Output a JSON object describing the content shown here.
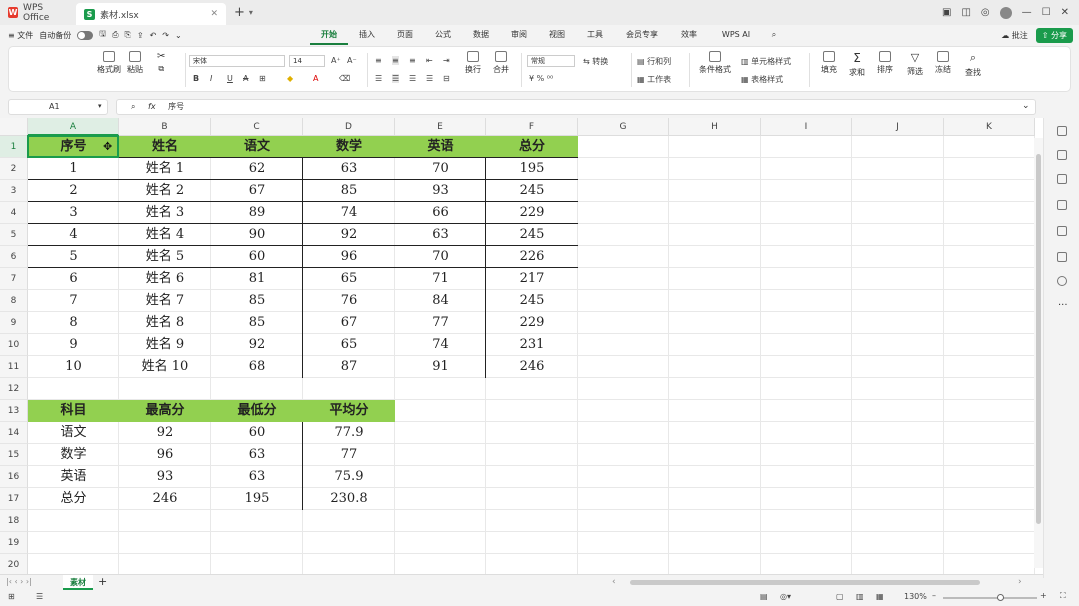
{
  "titlebar": {
    "app_tab": "WPS Office",
    "file_tab": "素材.xlsx",
    "new_tab_label": "+"
  },
  "menubar": {
    "file": "≡ 文件",
    "autosave": "自动备份",
    "tabs": [
      "开始",
      "插入",
      "页面",
      "公式",
      "数据",
      "审阅",
      "视图",
      "工具",
      "会员专享",
      "效率",
      "WPS AI"
    ],
    "active_tab": "开始",
    "share": "分享",
    "comment": "批注"
  },
  "ribbon": {
    "format_painter": "格式刷",
    "paste": "粘贴",
    "font_name": "宋体",
    "font_size": "14",
    "wrap": "换行",
    "merge": "合并",
    "number_format": "常规",
    "convert": "转换",
    "rows_cols": "行和列",
    "worksheet": "工作表",
    "cond_format": "条件格式",
    "cell_style": "单元格样式",
    "table_style": "表格样式",
    "fill": "填充",
    "sum": "求和",
    "sort": "排序",
    "filter": "筛选",
    "freeze": "冻结",
    "find": "查找"
  },
  "formula_bar": {
    "name_box": "A1",
    "fx": "fx",
    "content": "序号"
  },
  "grid": {
    "columns": [
      "A",
      "B",
      "C",
      "D",
      "E",
      "F",
      "G",
      "H",
      "I",
      "J",
      "K"
    ],
    "rows": [
      "1",
      "2",
      "3",
      "4",
      "5",
      "6",
      "7",
      "8",
      "9",
      "10",
      "11",
      "12",
      "13",
      "14",
      "15",
      "16",
      "17",
      "18",
      "19",
      "20"
    ],
    "table1": {
      "headers": [
        "序号",
        "姓名",
        "语文",
        "数学",
        "英语",
        "总分"
      ],
      "data": [
        [
          "1",
          "姓名 1",
          "62",
          "63",
          "70",
          "195"
        ],
        [
          "2",
          "姓名 2",
          "67",
          "85",
          "93",
          "245"
        ],
        [
          "3",
          "姓名 3",
          "89",
          "74",
          "66",
          "229"
        ],
        [
          "4",
          "姓名 4",
          "90",
          "92",
          "63",
          "245"
        ],
        [
          "5",
          "姓名 5",
          "60",
          "96",
          "70",
          "226"
        ],
        [
          "6",
          "姓名 6",
          "81",
          "65",
          "71",
          "217"
        ],
        [
          "7",
          "姓名 7",
          "85",
          "76",
          "84",
          "245"
        ],
        [
          "8",
          "姓名 8",
          "85",
          "67",
          "77",
          "229"
        ],
        [
          "9",
          "姓名 9",
          "92",
          "65",
          "74",
          "231"
        ],
        [
          "10",
          "姓名 10",
          "68",
          "87",
          "91",
          "246"
        ]
      ]
    },
    "table2": {
      "headers": [
        "科目",
        "最高分",
        "最低分",
        "平均分"
      ],
      "data": [
        [
          "语文",
          "92",
          "60",
          "77.9"
        ],
        [
          "数学",
          "96",
          "63",
          "77"
        ],
        [
          "英语",
          "93",
          "63",
          "75.9"
        ],
        [
          "总分",
          "246",
          "195",
          "230.8"
        ]
      ]
    }
  },
  "sheets": {
    "active": "素材",
    "add": "+"
  },
  "status": {
    "zoom": "130%"
  }
}
